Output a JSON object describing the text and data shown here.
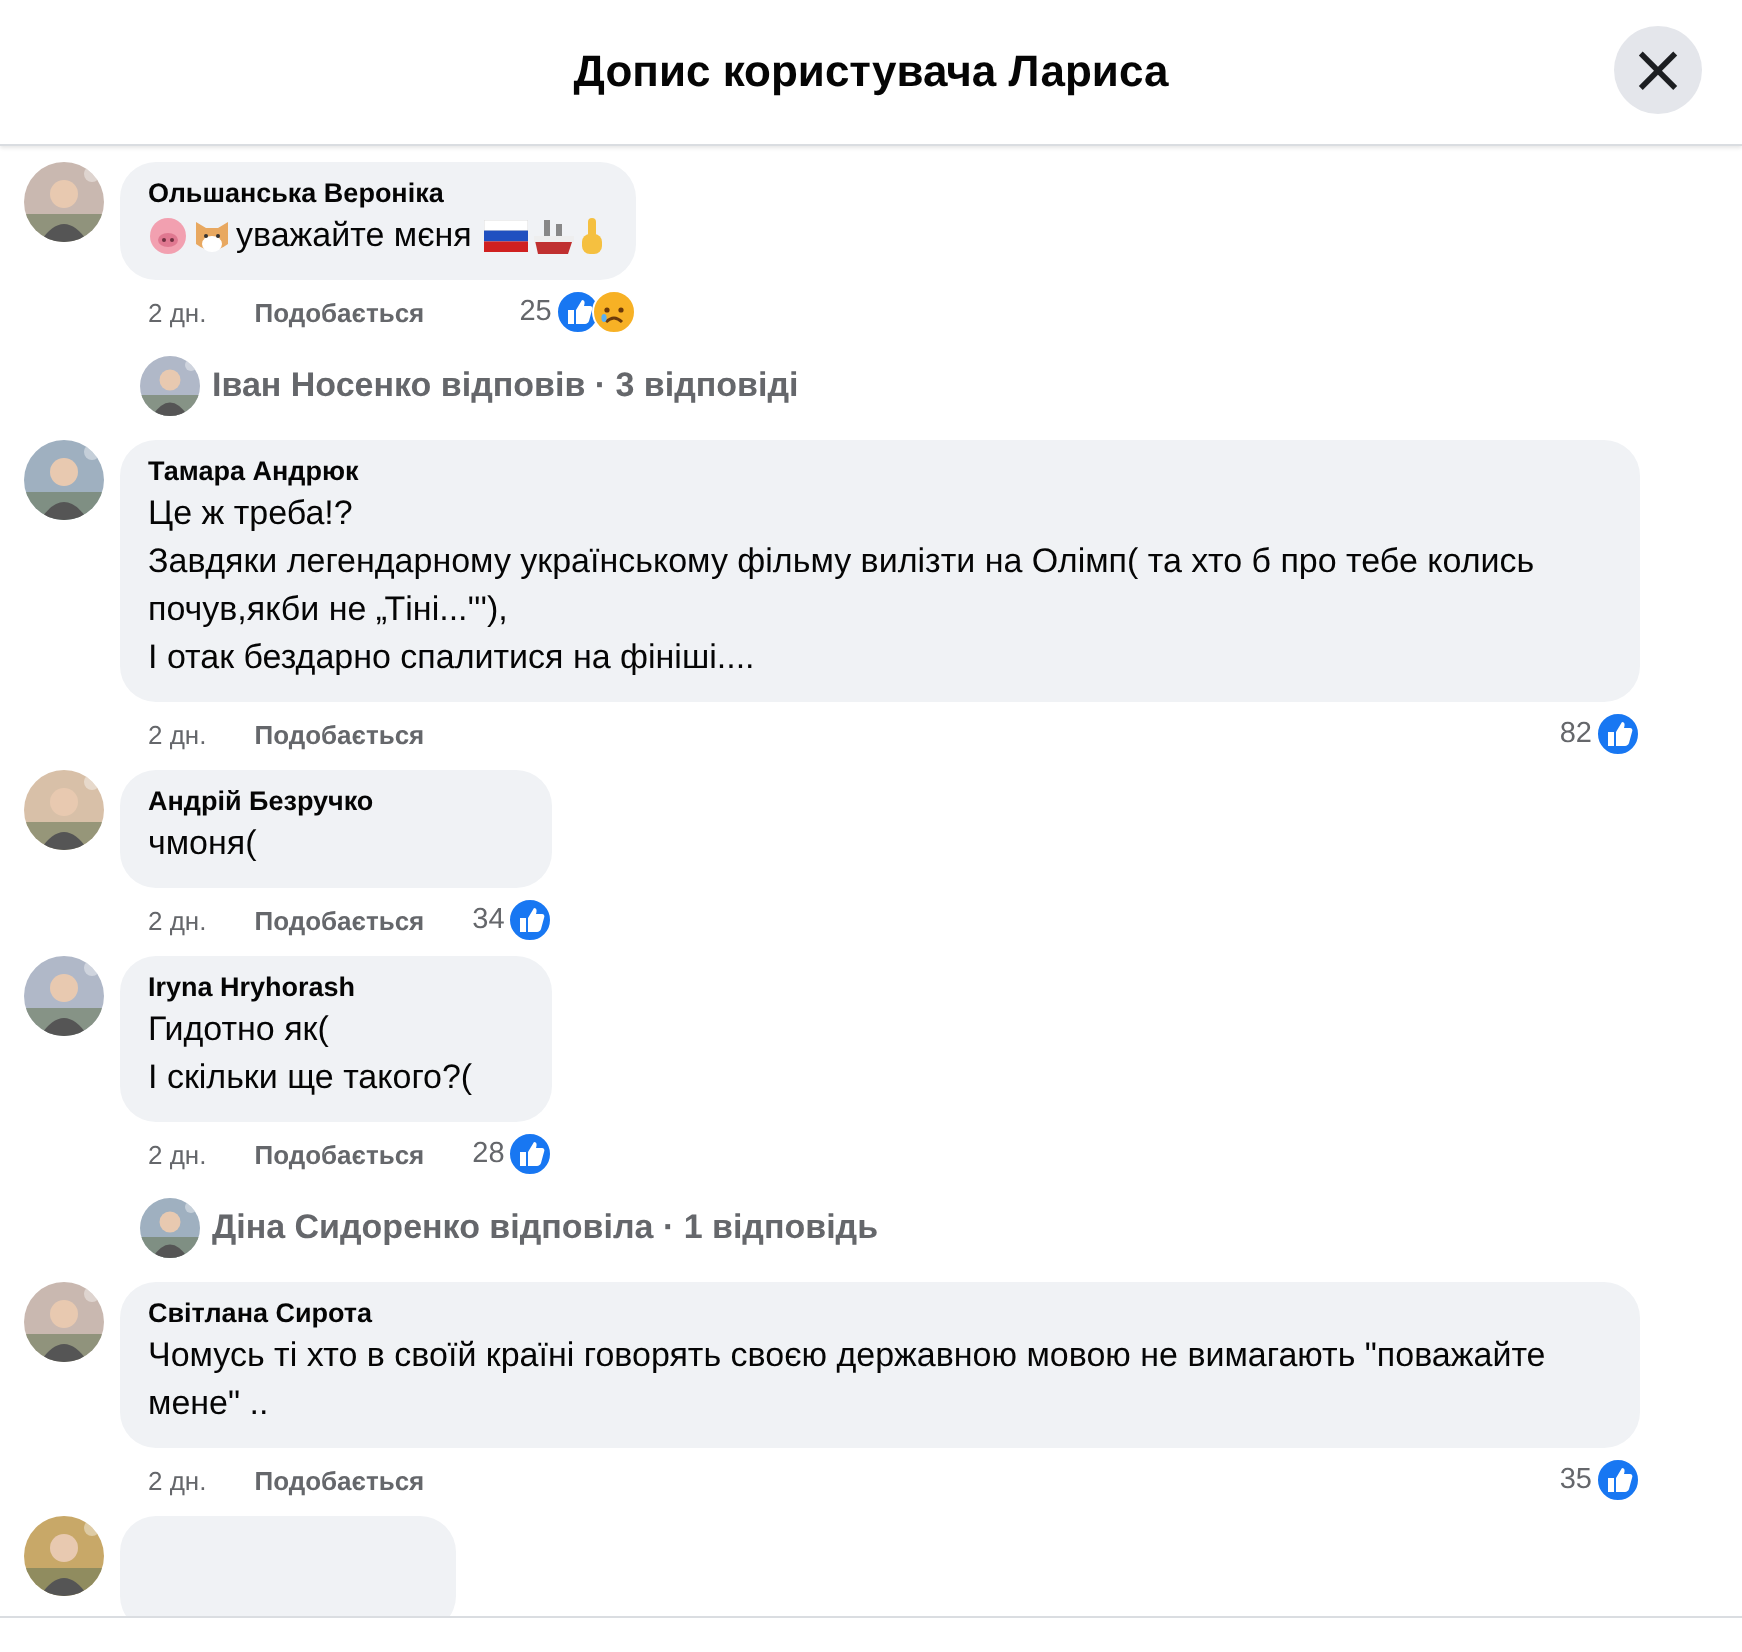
{
  "header": {
    "title": "Допис користувача Лариса",
    "close": "×"
  },
  "comments": [
    {
      "kind": "comment",
      "name": "Ольшанська Вероніка",
      "emoji_before": [
        {
          "kind": "pig"
        },
        {
          "kind": "dog"
        }
      ],
      "lines": [
        "уважайте мєня"
      ],
      "emoji_after": [
        {
          "kind": "flag"
        },
        {
          "kind": "ship"
        },
        {
          "kind": "finger"
        }
      ],
      "time": "2 дн.",
      "like": "Подобається",
      "count": "25",
      "reactions": [
        {
          "kind": "like"
        },
        {
          "kind": "sad"
        }
      ]
    },
    {
      "kind": "replies",
      "text": "Іван Носенко відповів · 3 відповіді"
    },
    {
      "kind": "comment",
      "name": "Тамара Андрюк",
      "lines": [
        "Це ж треба!?",
        "Завдяки легендарному українському фільму вилізти на Олімп( та хто б про тебе колись почув,якби не „Тіні...'''),",
        "І отак бездарно спалитися на фініші...."
      ],
      "time": "2 дн.",
      "like": "Подобається",
      "count": "82",
      "reactions": [
        {
          "kind": "like"
        }
      ]
    },
    {
      "kind": "comment",
      "name": "Андрій Безручко",
      "lines": [
        "чмоня("
      ],
      "time": "2 дн.",
      "like": "Подобається",
      "count": "34",
      "reactions": [
        {
          "kind": "like"
        }
      ]
    },
    {
      "kind": "comment",
      "name": "Iryna Hryhorash",
      "lines": [
        "Гидотно як(",
        "І скільки ще такого?("
      ],
      "time": "2 дн.",
      "like": "Подобається",
      "count": "28",
      "reactions": [
        {
          "kind": "like"
        }
      ]
    },
    {
      "kind": "replies",
      "text": "Діна Сидоренко відповіла · 1 відповідь"
    },
    {
      "kind": "comment",
      "name": "Світлана Сирота",
      "lines": [
        "Чомусь ті хто в своїй країні говорять своєю державною мовою не вимагають \"поважайте мене\" .."
      ],
      "time": "2 дн.",
      "like": "Подобається",
      "count": "35",
      "reactions": [
        {
          "kind": "like"
        }
      ]
    },
    {
      "kind": "partial"
    }
  ]
}
